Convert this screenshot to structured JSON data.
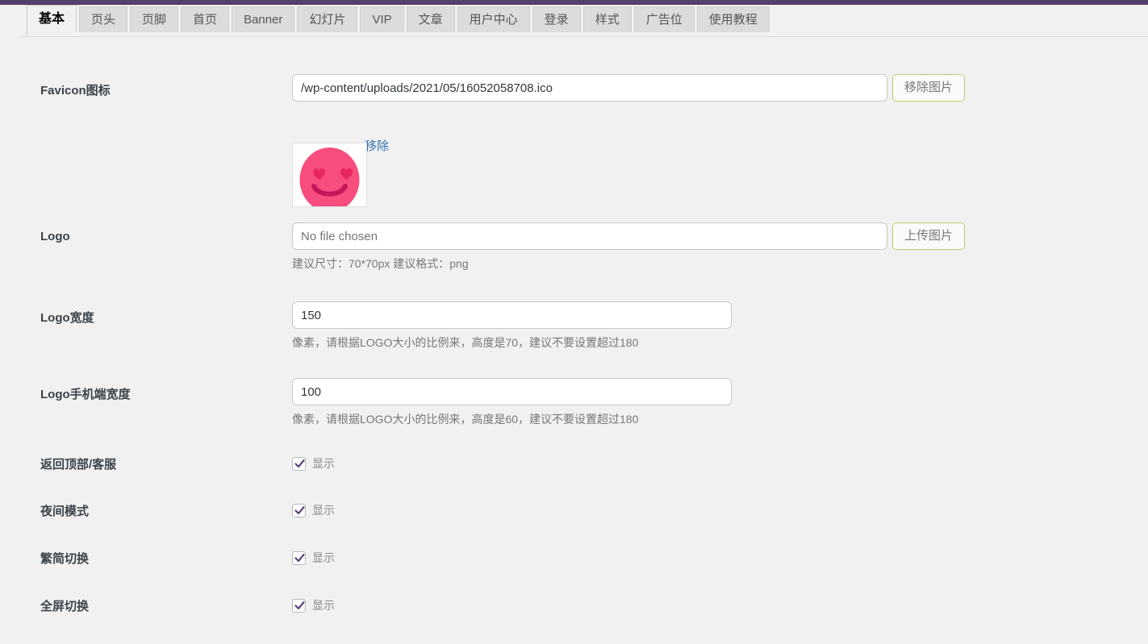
{
  "theme": {
    "admin_bar_color": "#53406c",
    "page_background": "#f1f1f1",
    "button_border_color": "#b9cc6a",
    "link_color": "#2e72b5",
    "checkbox_check_color": "#5a3f7a",
    "favicon_color": "#f74d7f",
    "favicon_detail_color": "#c2185b"
  },
  "tabs": [
    {
      "label": "基本",
      "active": true
    },
    {
      "label": "页头",
      "active": false
    },
    {
      "label": "页脚",
      "active": false
    },
    {
      "label": "首页",
      "active": false
    },
    {
      "label": "Banner",
      "active": false
    },
    {
      "label": "幻灯片",
      "active": false
    },
    {
      "label": "VIP",
      "active": false
    },
    {
      "label": "文章",
      "active": false
    },
    {
      "label": "用户中心",
      "active": false
    },
    {
      "label": "登录",
      "active": false
    },
    {
      "label": "样式",
      "active": false
    },
    {
      "label": "广告位",
      "active": false
    },
    {
      "label": "使用教程",
      "active": false
    }
  ],
  "form": {
    "favicon": {
      "label": "Favicon图标",
      "value": "/wp-content/uploads/2021/05/16052058708.ico",
      "placeholder": "",
      "button_label": "移除图片",
      "remove_link_label": "移除",
      "preview_icon": "smiling-face-with-hearts-icon"
    },
    "logo": {
      "label": "Logo",
      "value": "",
      "placeholder": "No file chosen",
      "button_label": "上传图片",
      "hint": "建议尺寸：70*70px 建议格式：png"
    },
    "logo_width": {
      "label": "Logo宽度",
      "value": "150",
      "placeholder": "",
      "hint": "像素，请根据LOGO大小的比例来，高度是70，建议不要设置超过180"
    },
    "logo_mobile_width": {
      "label": "Logo手机端宽度",
      "value": "100",
      "placeholder": "",
      "hint": "像素，请根据LOGO大小的比例来，高度是60，建议不要设置超过180"
    },
    "toggles": [
      {
        "label": "返回顶部/客服",
        "checkbox_label": "显示",
        "checked": true
      },
      {
        "label": "夜间模式",
        "checkbox_label": "显示",
        "checked": true
      },
      {
        "label": "繁简切换",
        "checkbox_label": "显示",
        "checked": true
      },
      {
        "label": "全屏切换",
        "checkbox_label": "显示",
        "checked": true
      }
    ]
  }
}
